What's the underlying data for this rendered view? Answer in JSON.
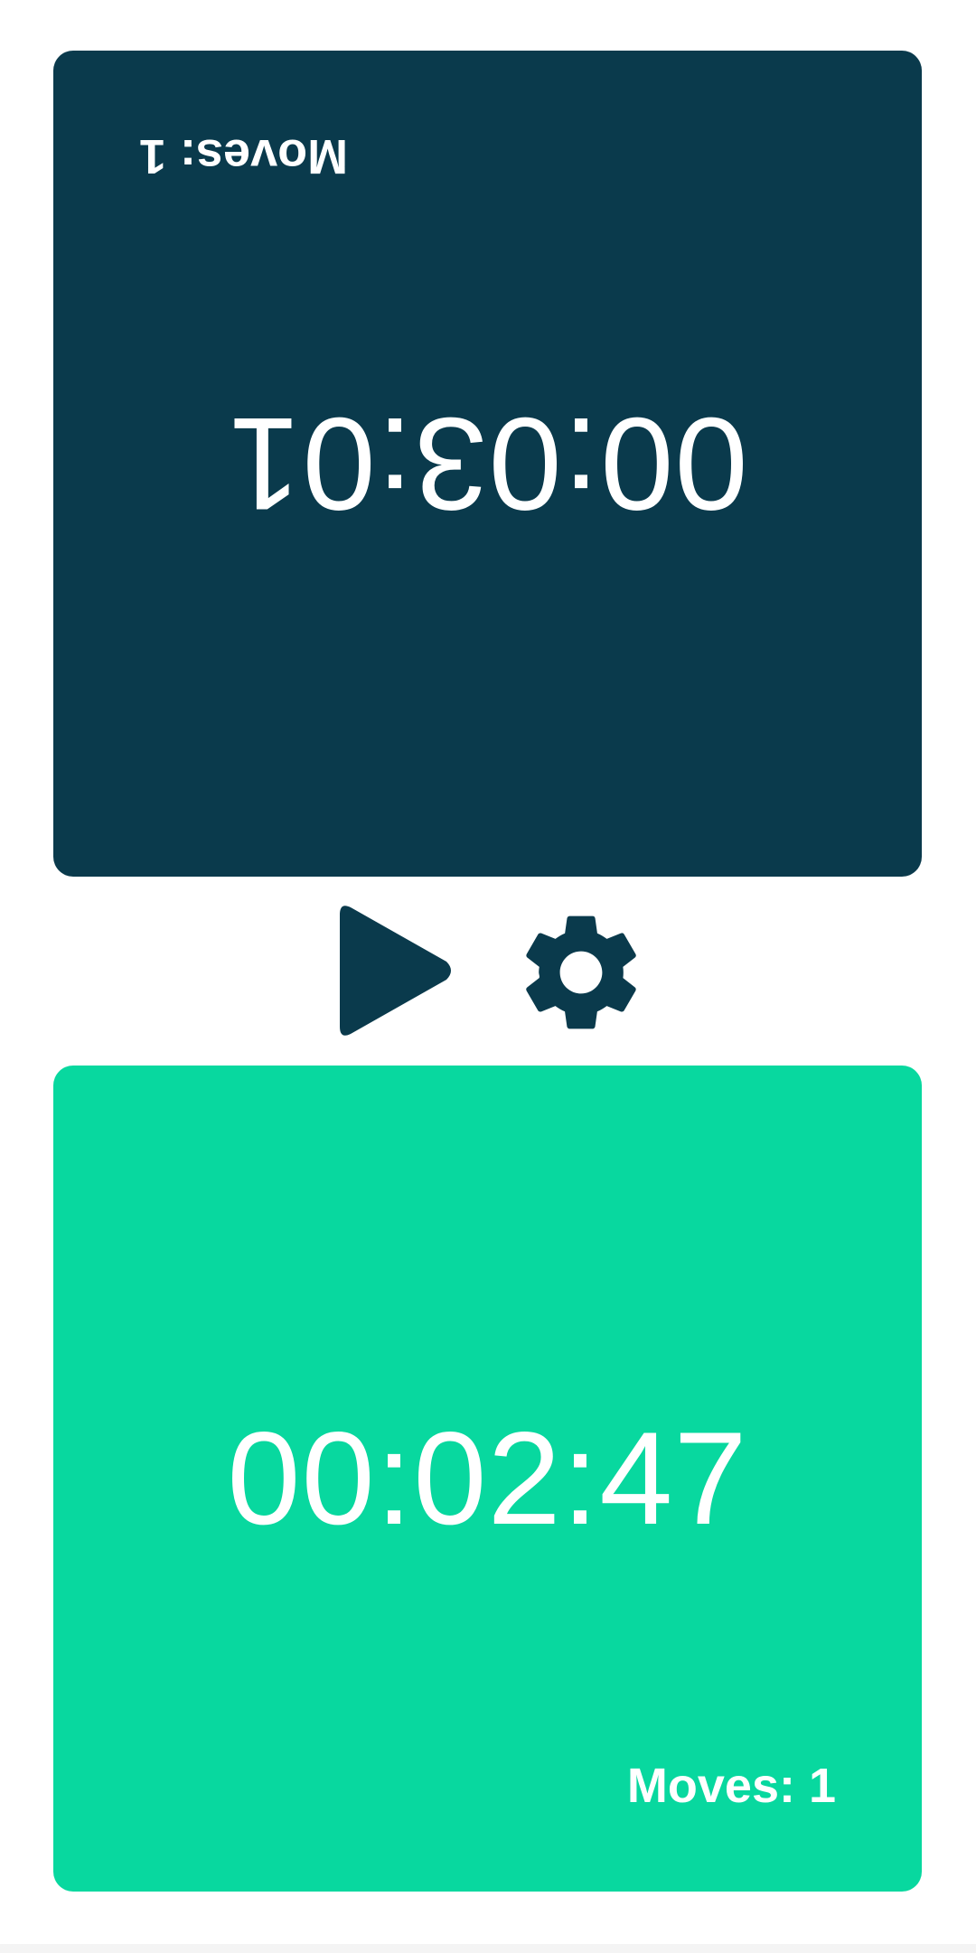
{
  "colors": {
    "opponent_panel": "#0a3a4c",
    "active_panel": "#08d89f",
    "icon": "#0a3a4c",
    "text": "#ffffff"
  },
  "opponent_clock": {
    "time": "00:03:01",
    "moves": "Moves: 1",
    "orientation": "rotated-180"
  },
  "player_clock": {
    "time": "00:02:47",
    "moves": "Moves: 1"
  },
  "controls": {
    "play_icon": "play-icon",
    "settings_icon": "gear-icon"
  }
}
